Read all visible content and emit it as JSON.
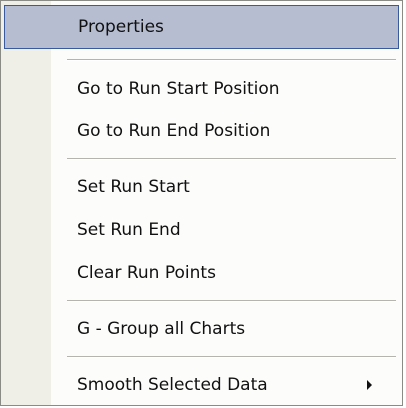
{
  "context_menu": {
    "items": [
      {
        "label": "Properties",
        "highlighted": true
      },
      {
        "label": "Go to Run Start Position"
      },
      {
        "label": "Go to Run End Position"
      },
      {
        "label": "Set Run Start"
      },
      {
        "label": "Set Run End"
      },
      {
        "label": "Clear Run Points"
      },
      {
        "label": "G - Group all Charts"
      },
      {
        "label": "Smooth Selected Data",
        "submenu": true,
        "submenu_icon": "submenu-arrow-icon"
      }
    ],
    "colors": {
      "highlight_fill": "#b6bdd1",
      "highlight_border": "#3a5a9e",
      "gutter": "#efeee7",
      "background": "#fcfcfb"
    }
  }
}
